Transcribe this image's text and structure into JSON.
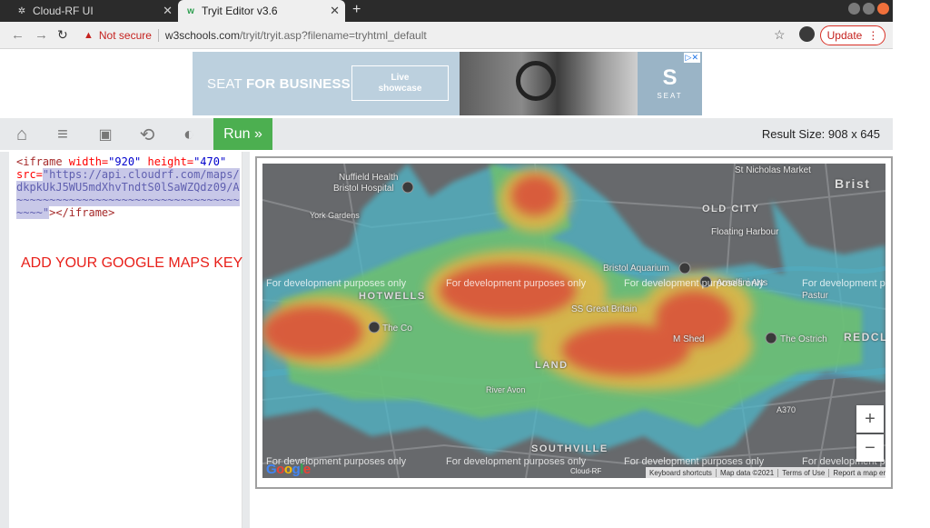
{
  "browser": {
    "tabs": [
      {
        "label": "Cloud-RF UI",
        "active": false
      },
      {
        "label": "Tryit Editor v3.6",
        "active": true
      }
    ],
    "new_tab": "+",
    "address": {
      "warning": "Not secure",
      "host": "w3schools.com",
      "path": "/tryit/tryit.asp?filename=tryhtml_default"
    },
    "update_label": "Update"
  },
  "ad": {
    "brand_light": "SEAT",
    "brand_bold": "FOR BUSINESS",
    "cta_line1": "Live",
    "cta_line2": "showcase",
    "logo_text": "SEAT"
  },
  "editor": {
    "run_label": "Run »",
    "result_size": "Result Size: 908 x 645",
    "code": {
      "open_tag": "<iframe",
      "width_attr": " width=",
      "width_val": "\"920\"",
      "height_attr": " height=",
      "height_val": "\"470\"",
      "src_attr": "src=",
      "src_val_1": "\"https://api.cloudrf.com/maps/",
      "src_val_2": "dkpkUkJ5WU5mdXhvTndtS0lSaWZQdz09/A",
      "src_val_3": "~~~~~~~~~~~~~~~~~~~~~~~~~~~~~~~~~~",
      "src_val_4": "~~~~\"",
      "close_tag": "></iframe>"
    },
    "note": "ADD YOUR GOOGLE MAPS KEY"
  },
  "map": {
    "labels": {
      "nuffield_1": "Nuffield Health",
      "nuffield_2": "Bristol Hospital",
      "st_nicholas": "St Nicholas Market",
      "old_city": "OLD CITY",
      "floating_harbour": "Floating Harbour",
      "hotwells": "HOTWELLS",
      "bristol_aquarium": "Bristol Aquarium",
      "ss_great_britain": "SS Great Britain",
      "arnolfini": "Arnolfini Arts",
      "m_shed": "M Shed",
      "redcliffe": "REDCLI",
      "bristol_edge": "Brist",
      "the_cottage": "The Co",
      "the_ostrich": "The Ostrich",
      "spike_island": "LAND",
      "southville": "SOUTHVILLE",
      "a370": "A370",
      "river_avon": "River Avon",
      "york_gardens": "York Gardens",
      "pastures": "Pastur"
    },
    "dev_watermark": "For development purposes only",
    "zoom_in": "+",
    "zoom_out": "−",
    "credit": "Cloud-RF",
    "footer": [
      "Keyboard shortcuts",
      "Map data ©2021",
      "Terms of Use",
      "Report a map erro"
    ],
    "google_letters": [
      "G",
      "o",
      "o",
      "g",
      "l",
      "e"
    ]
  },
  "colors": {
    "run_green": "#4caf50",
    "note_red": "#e8201a",
    "heat_red": "#d9533b",
    "heat_orange": "#e09a43",
    "heat_green": "#6fc26a",
    "heat_cyan": "#4fb7c9"
  },
  "icons": [
    "home-icon",
    "menu-icon",
    "save-icon",
    "rotate-icon",
    "contrast-icon",
    "star-icon",
    "profile-icon"
  ]
}
